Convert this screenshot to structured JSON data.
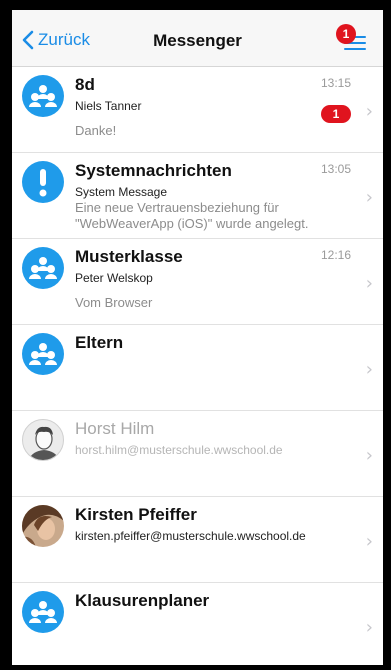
{
  "navbar": {
    "back_label": "Zurück",
    "title": "Messenger",
    "menu_badge": "1"
  },
  "conversations": [
    {
      "name": "8d",
      "subtitle": "Niels Tanner",
      "preview": "Danke!",
      "time": "13:15",
      "unread": "1",
      "avatar": "group-icon"
    },
    {
      "name": "Systemnachrichten",
      "subtitle": "System Message",
      "preview_line1": "Eine neue Vertrauensbeziehung für",
      "preview_line2": "\"WebWeaverApp (iOS)\" wurde angelegt.",
      "time": "13:05",
      "avatar": "exclamation-icon"
    },
    {
      "name": "Musterklasse",
      "subtitle": "Peter Welskop",
      "preview": "Vom Browser",
      "time": "12:16",
      "avatar": "group-icon"
    },
    {
      "name": "Eltern",
      "avatar": "group-icon"
    },
    {
      "name": "Horst Hilm",
      "subtitle": "horst.hilm@musterschule.wwschool.de",
      "avatar": "person-placeholder"
    },
    {
      "name": "Kirsten Pfeiffer",
      "subtitle": "kirsten.pfeiffer@musterschule.wwschool.de",
      "avatar": "user-photo"
    },
    {
      "name": "Klausurenplaner",
      "avatar": "group-icon"
    }
  ],
  "colors": {
    "accent": "#1a8ce6",
    "avatar_blue": "#1f9bea",
    "badge_red": "#e0141e"
  }
}
